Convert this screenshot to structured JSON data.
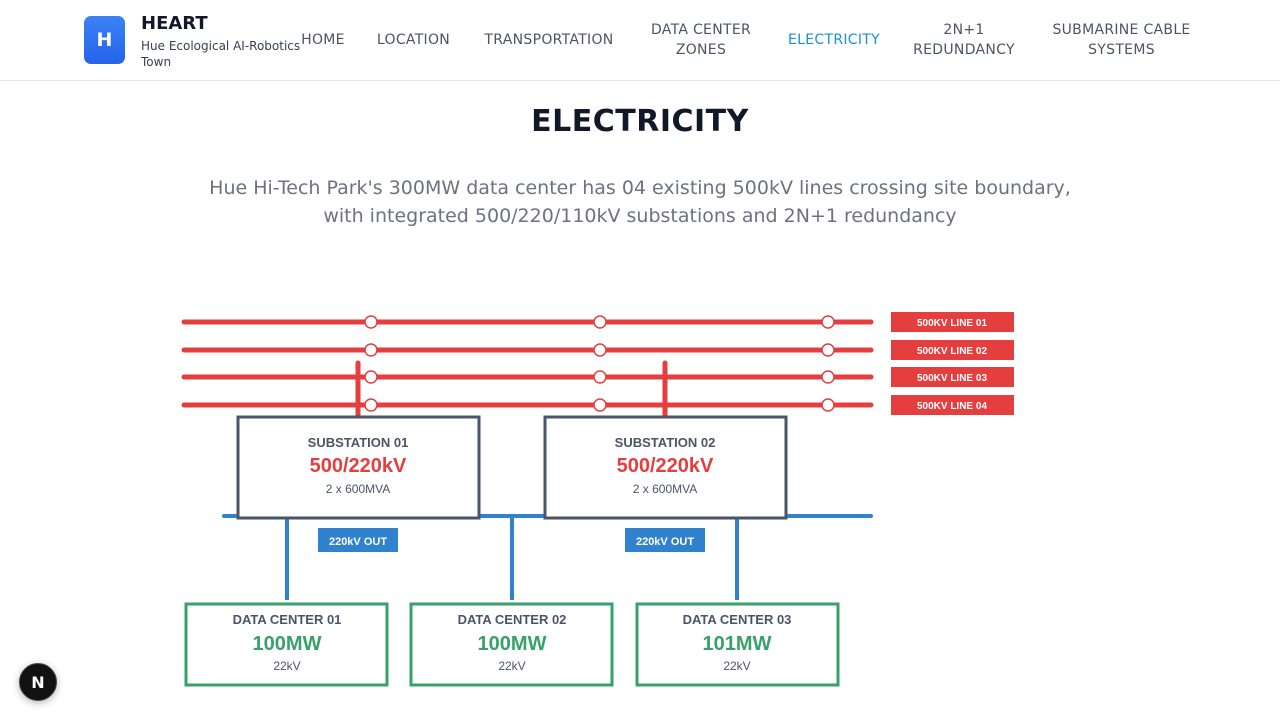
{
  "header": {
    "logo_letter": "H",
    "brand_title": "HEART",
    "brand_subtitle": "Hue Ecological AI-Robotics Town",
    "nav": {
      "home": "HOME",
      "location": "LOCATION",
      "transportation": "TRANSPORTATION",
      "data_center_zones_1": "DATA CENTER",
      "data_center_zones_2": "ZONES",
      "electricity": "ELECTRICITY",
      "redundancy_1": "2N+1",
      "redundancy_2": "REDUNDANCY",
      "submarine_1": "SUBMARINE CABLE",
      "submarine_2": "SYSTEMS"
    },
    "active_item": "ELECTRICITY",
    "active_color": "#1793d1"
  },
  "main": {
    "title": "ELECTRICITY",
    "subtitle_line1": "Hue Hi-Tech Park's 300MW data center has 04 existing 500kV lines crossing site boundary,",
    "subtitle_line2": "with integrated 500/220/110kV substations and 2N+1 redundancy"
  },
  "diagram": {
    "lines": [
      "500KV LINE 01",
      "500KV LINE 02",
      "500KV LINE 03",
      "500KV LINE 04"
    ],
    "substations": [
      {
        "name": "SUBSTATION 01",
        "voltage": "500/220kV",
        "capacity": "2 x 600MVA",
        "out_label": "220kV OUT"
      },
      {
        "name": "SUBSTATION 02",
        "voltage": "500/220kV",
        "capacity": "2 x 600MVA",
        "out_label": "220kV OUT"
      }
    ],
    "data_centers": [
      {
        "name": "DATA CENTER 01",
        "power": "100MW",
        "voltage": "22kV"
      },
      {
        "name": "DATA CENTER 02",
        "power": "100MW",
        "voltage": "22kV"
      },
      {
        "name": "DATA CENTER 03",
        "power": "101MW",
        "voltage": "22kV"
      }
    ],
    "colors": {
      "line_500kv": "#e53e3e",
      "line_220kv": "#3182ce",
      "substation_border": "#4a5568",
      "data_center": "#38a169",
      "label_dark": "#4a5568"
    }
  },
  "badge": {
    "letter": "N"
  }
}
